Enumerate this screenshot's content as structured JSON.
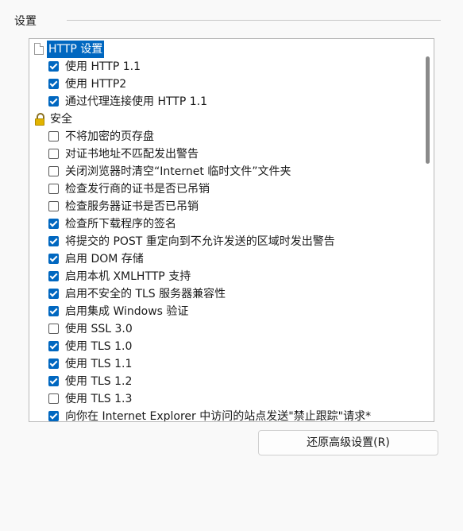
{
  "group": {
    "title": "设置"
  },
  "tree": {
    "rows": [
      {
        "kind": "category",
        "icon": "page-icon",
        "label": "HTTP 设置",
        "selected": true
      },
      {
        "kind": "option",
        "label": "使用 HTTP 1.1",
        "checked": true
      },
      {
        "kind": "option",
        "label": "使用 HTTP2",
        "checked": true
      },
      {
        "kind": "option",
        "label": "通过代理连接使用 HTTP 1.1",
        "checked": true
      },
      {
        "kind": "category",
        "icon": "lock-icon",
        "label": "安全",
        "selected": false
      },
      {
        "kind": "option",
        "label": "不将加密的页存盘",
        "checked": false
      },
      {
        "kind": "option",
        "label": "对证书地址不匹配发出警告",
        "checked": false
      },
      {
        "kind": "option",
        "label": "关闭浏览器时清空“Internet 临时文件”文件夹",
        "checked": false
      },
      {
        "kind": "option",
        "label": "检查发行商的证书是否已吊销",
        "checked": false
      },
      {
        "kind": "option",
        "label": "检查服务器证书是否已吊销",
        "checked": false
      },
      {
        "kind": "option",
        "label": "检查所下载程序的签名",
        "checked": true
      },
      {
        "kind": "option",
        "label": "将提交的 POST 重定向到不允许发送的区域时发出警告",
        "checked": true
      },
      {
        "kind": "option",
        "label": "启用 DOM 存储",
        "checked": true
      },
      {
        "kind": "option",
        "label": "启用本机 XMLHTTP 支持",
        "checked": true
      },
      {
        "kind": "option",
        "label": "启用不安全的 TLS 服务器兼容性",
        "checked": true
      },
      {
        "kind": "option",
        "label": "启用集成 Windows 验证",
        "checked": true
      },
      {
        "kind": "option",
        "label": "使用 SSL 3.0",
        "checked": false
      },
      {
        "kind": "option",
        "label": "使用 TLS 1.0",
        "checked": true
      },
      {
        "kind": "option",
        "label": "使用 TLS 1.1",
        "checked": true
      },
      {
        "kind": "option",
        "label": "使用 TLS 1.2",
        "checked": true
      },
      {
        "kind": "option",
        "label": "使用 TLS 1.3",
        "checked": false
      },
      {
        "kind": "option",
        "label": "向你在 Internet Explorer 中访问的站点发送\"禁止跟踪\"请求*",
        "checked": true
      }
    ]
  },
  "reset_button": {
    "label": "还原高级设置(R)"
  }
}
